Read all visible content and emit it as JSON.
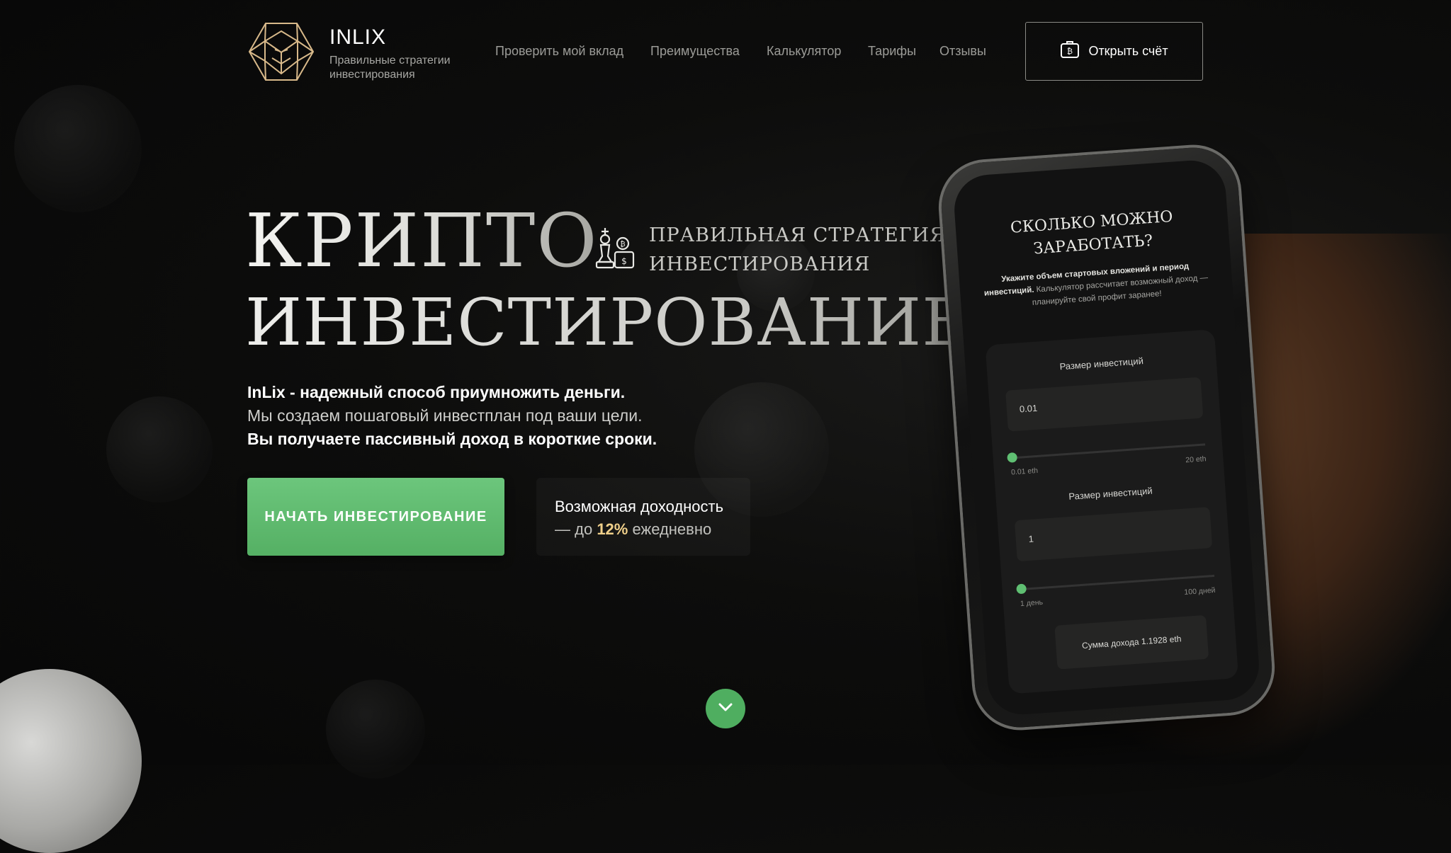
{
  "header": {
    "brand_name": "INLIX",
    "brand_tagline": "Правильные стратегии инвестирования",
    "nav": [
      {
        "label": "Проверить мой вклад"
      },
      {
        "label": "Преимущества"
      },
      {
        "label": "Калькулятор"
      },
      {
        "label": "Тарифы"
      },
      {
        "label": "Отзывы"
      }
    ],
    "open_account_label": "Открыть счёт",
    "open_account_icon": "wallet-bitcoin-icon"
  },
  "hero": {
    "title_line1": "КРИПТО",
    "title_line2": "ИНВЕСТИРОВАНИЕ",
    "side_line1": "ПРАВИЛЬНАЯ СТРАТЕГИЯ",
    "side_line2": "ИНВЕСТИРОВАНИЯ",
    "side_icon": "chess-king-coins-icon",
    "desc_line1": "InLix - надежный способ приумножить деньги.",
    "desc_line2": "Мы создаем пошаговый инвестплан под ваши цели.",
    "desc_line3": "Вы получаете пассивный доход в короткие сроки.",
    "cta_label": "НАЧАТЬ ИНВЕСТИРОВАНИЕ",
    "yield_line1": "Возможная доходность",
    "yield_prefix": "— до",
    "yield_percent": "12%",
    "yield_suffix": "ежедневно",
    "scroll_icon": "chevron-down-icon"
  },
  "phone": {
    "title_line1": "СКОЛЬКО МОЖНО",
    "title_line2": "ЗАРАБОТАТЬ?",
    "text_bold": "Укажите объем стартовых вложений и период инвестиций.",
    "text_rest": "Калькулятор рассчитает возможный доход — планируйте свой профит заранее!",
    "label1": "Размер инвестиций",
    "field1_value": "0.01",
    "range1_min": "0.01 eth",
    "range1_max": "20 eth",
    "label2": "Размер инвестиций",
    "field2_value": "1",
    "range2_min": "1 день",
    "range2_max": "100 дней",
    "sum_text": "Сумма дохода 1.1928 eth"
  },
  "colors": {
    "accent_green": "#5fbf72",
    "accent_gold": "#f0d08a",
    "background": "#0b0b0b"
  }
}
